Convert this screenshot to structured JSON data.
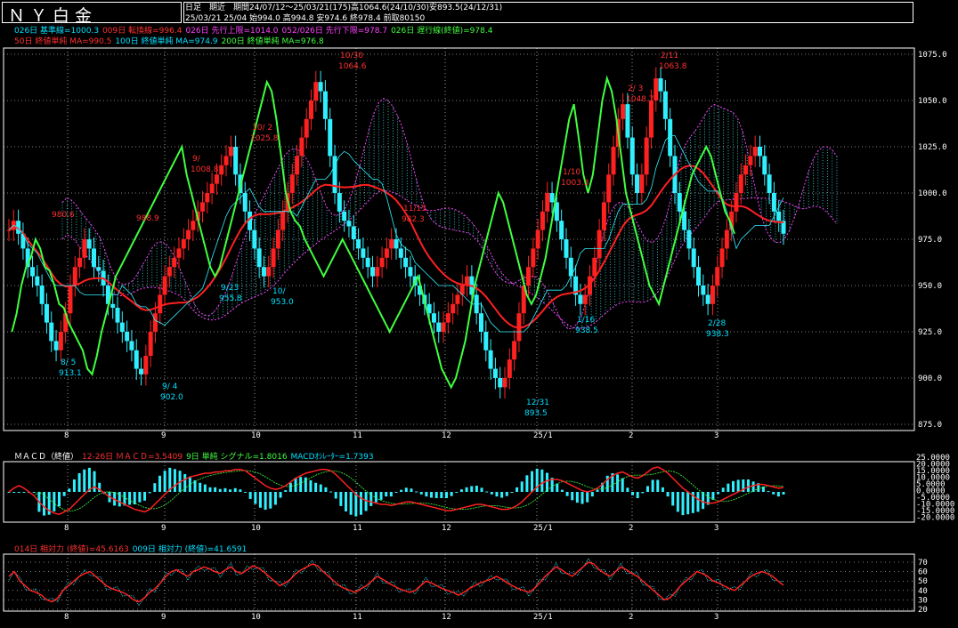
{
  "header": {
    "title": "ＮＹ白金",
    "line1": "日足　期近　期間24/07/12～25/03/21(175)高1064.6(24/10/30)安893.5(24/12/31)",
    "line2": "25/03/21 25/04 始994.0 高994.8 安974.6 終978.4 前取80150"
  },
  "legend_main_1": [
    {
      "text": "026日 基準線=1000.3",
      "color": "#00e0ff"
    },
    {
      "text": "009日 転換線=996.4",
      "color": "#ff3030"
    },
    {
      "text": "026日 先行上限=1014.0",
      "color": "#ff40ff"
    },
    {
      "text": "052/026日 先行下限=978.7",
      "color": "#ff40ff"
    },
    {
      "text": "026日 遅行線(終値)=978.4",
      "color": "#40ff40"
    }
  ],
  "legend_main_2": [
    {
      "text": "50日 終値単純 MA=990.5",
      "color": "#ff3030"
    },
    {
      "text": "100日 終値単純 MA=974.9",
      "color": "#00e0ff"
    },
    {
      "text": "200日 終値単純 MA=976.8",
      "color": "#40ff40"
    }
  ],
  "legend_macd": [
    {
      "text": "ＭＡＣＤ（終値）",
      "color": "#ffffff"
    },
    {
      "text": "12-26日 ＭＡＣＤ=3.5409",
      "color": "#ff3030"
    },
    {
      "text": "9日 単純 シグナル=1.8016",
      "color": "#40ff40"
    },
    {
      "text": "MACDｵｼﾚｰﾀｰ=1.7393",
      "color": "#00e0ff"
    }
  ],
  "legend_rsi": [
    {
      "text": "014日 相対力 (終値)=45.6163",
      "color": "#ff3030"
    },
    {
      "text": "009日 相対力 (終値)=41.6591",
      "color": "#00e0ff"
    }
  ],
  "chart_data": {
    "type": "candlestick",
    "x_labels": [
      "8",
      "9",
      "10",
      "11",
      "12",
      "25/1",
      "2",
      "3"
    ],
    "main_y_ticks": [
      "1075.0",
      "1050.0",
      "1025.0",
      "1000.0",
      "975.0",
      "950.0",
      "925.0",
      "900.0",
      "875.0"
    ],
    "main_ylim": [
      875,
      1085
    ],
    "macd_y_ticks": [
      "25.0000",
      "20.0000",
      "15.0000",
      "10.0000",
      "5.0000",
      "0.0000",
      "-5.0000",
      "-10.0000",
      "-15.0000",
      "-20.0000"
    ],
    "rsi_y_ticks": [
      "70",
      "60",
      "50",
      "40",
      "30",
      "20"
    ],
    "annotations": [
      {
        "date": "8/ 5",
        "value": "913.1",
        "color": "#00e0ff"
      },
      {
        "date": "9/ 4",
        "value": "902.0",
        "color": "#00e0ff"
      },
      {
        "date": "9/23",
        "value": "955.8",
        "color": "#00e0ff"
      },
      {
        "date": "10/",
        "value": "953.0",
        "color": "#00e0ff"
      },
      {
        "date": "12/31",
        "value": "893.5",
        "color": "#00e0ff"
      },
      {
        "date": "1/16",
        "value": "938.5",
        "color": "#00e0ff"
      },
      {
        "date": "2/28",
        "value": "938.3",
        "color": "#00e0ff"
      },
      {
        "date": "",
        "value": "980.6",
        "color": "#ff3030"
      },
      {
        "date": "",
        "value": "988.9",
        "color": "#ff3030"
      },
      {
        "date": "9/",
        "value": "1008.8",
        "color": "#ff3030"
      },
      {
        "date": "10/ 2",
        "value": "1025.8",
        "color": "#ff3030"
      },
      {
        "date": "10/30",
        "value": "1064.6",
        "color": "#ff3030"
      },
      {
        "date": "11/15",
        "value": "982.3",
        "color": "#ff3030"
      },
      {
        "date": "1/10",
        "value": "1003.3",
        "color": "#ff3030"
      },
      {
        "date": "2/ 3",
        "value": "1048.7",
        "color": "#ff3030"
      },
      {
        "date": "2/11",
        "value": "1063.8",
        "color": "#ff3030"
      }
    ],
    "close_series": [
      980,
      985,
      978,
      970,
      960,
      955,
      950,
      940,
      930,
      920,
      915,
      925,
      935,
      950,
      960,
      965,
      975,
      970,
      960,
      958,
      950,
      940,
      938,
      930,
      925,
      920,
      915,
      905,
      902,
      912,
      925,
      935,
      945,
      955,
      960,
      965,
      970,
      975,
      980,
      985,
      990,
      995,
      1000,
      1005,
      1010,
      1015,
      1020,
      1025,
      1010,
      1000,
      990,
      980,
      970,
      960,
      955,
      960,
      970,
      980,
      990,
      1000,
      1010,
      1020,
      1030,
      1040,
      1050,
      1060,
      1055,
      1040,
      1020,
      1000,
      990,
      985,
      982,
      975,
      970,
      965,
      960,
      955,
      960,
      965,
      970,
      975,
      970,
      965,
      960,
      955,
      950,
      945,
      940,
      935,
      930,
      925,
      930,
      935,
      940,
      945,
      950,
      955,
      945,
      935,
      925,
      915,
      905,
      900,
      895,
      900,
      910,
      920,
      935,
      950,
      960,
      970,
      980,
      990,
      1000,
      995,
      985,
      975,
      965,
      955,
      945,
      940,
      945,
      955,
      965,
      980,
      995,
      1010,
      1025,
      1040,
      1048,
      1030,
      1010,
      1000,
      1010,
      1030,
      1050,
      1062,
      1055,
      1040,
      1020,
      1000,
      990,
      980,
      970,
      960,
      950,
      945,
      940,
      950,
      960,
      970,
      980,
      990,
      1000,
      1010,
      1015,
      1020,
      1025,
      1020,
      1010,
      1000,
      990,
      985,
      978
    ],
    "macd_series": [
      0,
      3,
      5,
      3,
      0,
      -3,
      -8,
      -12,
      -15,
      -17,
      -18,
      -16,
      -14,
      -10,
      -6,
      -2,
      2,
      4,
      2,
      -1,
      -4,
      -6,
      -8,
      -10,
      -12,
      -14,
      -15,
      -16,
      -14,
      -10,
      -6,
      -2,
      2,
      5,
      8,
      10,
      12,
      13,
      14,
      15,
      15,
      16,
      16,
      17,
      17,
      18,
      18,
      17,
      14,
      11,
      8,
      5,
      3,
      2,
      3,
      5,
      8,
      11,
      13,
      15,
      16,
      17,
      18,
      18,
      17,
      14,
      10,
      6,
      2,
      -2,
      -5,
      -7,
      -8,
      -9,
      -10,
      -10,
      -11,
      -10,
      -9,
      -8,
      -8,
      -9,
      -10,
      -11,
      -12,
      -13,
      -14,
      -15,
      -15,
      -14,
      -13,
      -12,
      -11,
      -10,
      -10,
      -11,
      -12,
      -13,
      -14,
      -14,
      -13,
      -11,
      -8,
      -4,
      0,
      4,
      7,
      9,
      10,
      10,
      9,
      7,
      5,
      3,
      1,
      0,
      1,
      3,
      6,
      10,
      13,
      15,
      16,
      14,
      12,
      11,
      13,
      16,
      19,
      20,
      18,
      15,
      11,
      7,
      3,
      0,
      -3,
      -6,
      -8,
      -9,
      -9,
      -8,
      -6,
      -4,
      -2,
      0,
      2,
      4,
      5,
      6,
      6,
      5,
      4,
      3,
      3.54
    ],
    "rsi_series": [
      55,
      60,
      50,
      45,
      40,
      38,
      35,
      30,
      28,
      32,
      40,
      45,
      50,
      55,
      58,
      60,
      55,
      50,
      45,
      42,
      40,
      38,
      35,
      30,
      28,
      32,
      38,
      42,
      48,
      55,
      60,
      62,
      58,
      55,
      60,
      62,
      65,
      63,
      60,
      58,
      62,
      65,
      60,
      58,
      62,
      66,
      64,
      60,
      55,
      50,
      45,
      48,
      52,
      58,
      62,
      65,
      68,
      66,
      60,
      55,
      50,
      45,
      42,
      40,
      38,
      42,
      45,
      50,
      55,
      52,
      48,
      45,
      42,
      40,
      38,
      40,
      45,
      50,
      48,
      45,
      42,
      40,
      38,
      35,
      38,
      42,
      45,
      48,
      50,
      52,
      55,
      52,
      48,
      45,
      42,
      40,
      38,
      42,
      48,
      55,
      60,
      65,
      62,
      58,
      55,
      60,
      65,
      70,
      68,
      62,
      58,
      55,
      60,
      65,
      62,
      58,
      55,
      50,
      45,
      40,
      35,
      30,
      32,
      38,
      45,
      50,
      55,
      60,
      58,
      55,
      50,
      48,
      45,
      42,
      40,
      45,
      50,
      55,
      58,
      60,
      58,
      55,
      50,
      45.6
    ]
  }
}
